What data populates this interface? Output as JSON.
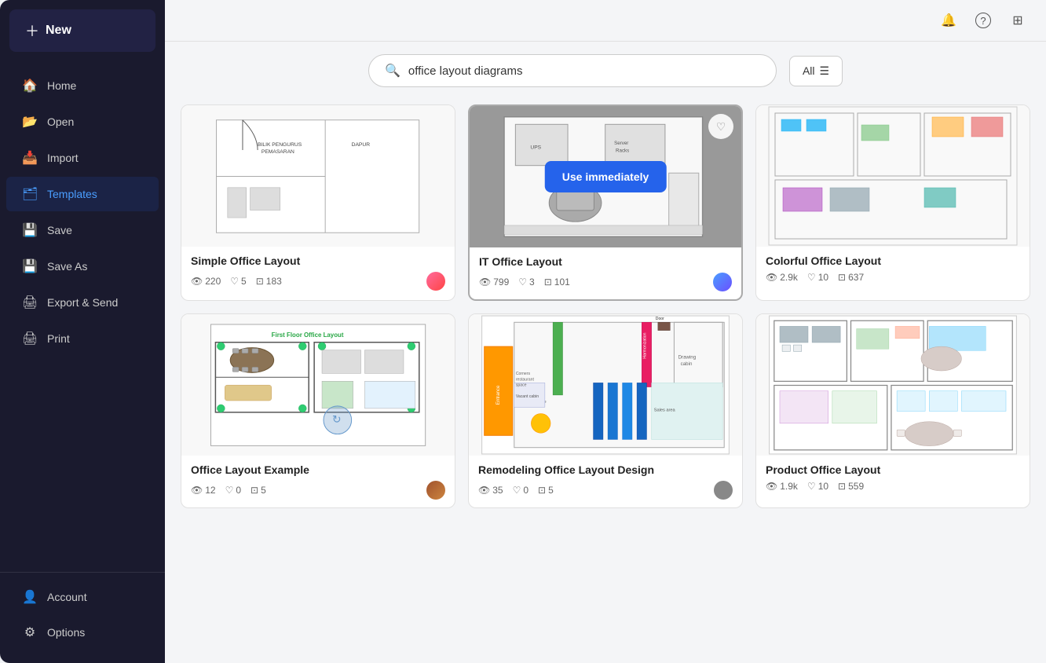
{
  "sidebar": {
    "new_label": "New",
    "items": [
      {
        "id": "home",
        "label": "Home",
        "icon": "🏠",
        "active": false
      },
      {
        "id": "open",
        "label": "Open",
        "icon": "📂",
        "active": false
      },
      {
        "id": "import",
        "label": "Import",
        "icon": "📥",
        "active": false
      },
      {
        "id": "templates",
        "label": "Templates",
        "icon": "🗂",
        "active": true
      },
      {
        "id": "save",
        "label": "Save",
        "icon": "💾",
        "active": false
      },
      {
        "id": "save-as",
        "label": "Save As",
        "icon": "💾",
        "active": false
      },
      {
        "id": "export",
        "label": "Export & Send",
        "icon": "🖨",
        "active": false
      },
      {
        "id": "print",
        "label": "Print",
        "icon": "🖨",
        "active": false
      }
    ],
    "bottom_items": [
      {
        "id": "account",
        "label": "Account",
        "icon": "👤"
      },
      {
        "id": "options",
        "label": "Options",
        "icon": "⚙"
      }
    ]
  },
  "topbar": {
    "notification_icon": "🔔",
    "help_icon": "?",
    "apps_icon": "⊞"
  },
  "search": {
    "placeholder": "office layout diagrams",
    "value": "office layout diagrams",
    "filter_label": "All"
  },
  "templates": {
    "cards": [
      {
        "id": "simple-office",
        "title": "Simple Office Layout",
        "views": "220",
        "likes": "5",
        "copies": "183",
        "avatar_class": "avatar-pink"
      },
      {
        "id": "it-office",
        "title": "IT Office Layout",
        "views": "799",
        "likes": "3",
        "copies": "101",
        "avatar_class": "avatar-blue",
        "highlighted": true,
        "show_use_btn": true
      },
      {
        "id": "colorful-office",
        "title": "Colorful Office Layout",
        "views": "2.9k",
        "likes": "10",
        "copies": "637",
        "avatar_class": "avatar-blue",
        "partial": true
      },
      {
        "id": "office-example",
        "title": "Office Layout Example",
        "views": "12",
        "likes": "0",
        "copies": "5",
        "avatar_class": "avatar-brown"
      },
      {
        "id": "remodeling",
        "title": "Remodeling Office Layout Design",
        "views": "35",
        "likes": "0",
        "copies": "5",
        "avatar_class": "avatar-gray"
      },
      {
        "id": "product-office",
        "title": "Product Office Layout",
        "views": "1.9k",
        "likes": "10",
        "copies": "559",
        "avatar_class": "avatar-blue",
        "partial": true
      }
    ],
    "use_immediately_label": "Use immediately"
  }
}
